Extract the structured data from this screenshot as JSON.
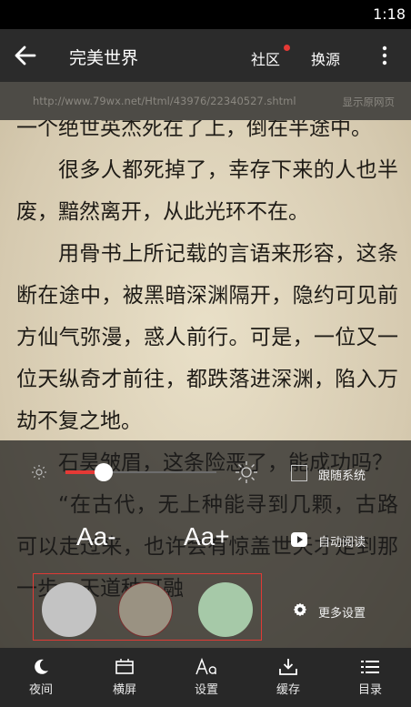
{
  "status_bar": {
    "time": "1:18"
  },
  "header": {
    "title": "完美世界",
    "community": "社区",
    "change_source": "换源"
  },
  "url_bar": {
    "url": "http://www.79wx.net/Html/43976/22340527.shtml",
    "show_original": "显示原网页"
  },
  "content": {
    "paragraphs": [
      {
        "text": "一个绝世英杰死在了上，倒在半途中。",
        "indent": false
      },
      {
        "text": "很多人都死掉了，幸存下来的人也半废，黯然离开，从此光环不在。",
        "indent": true
      },
      {
        "text": "用骨书上所记载的言语来形容，这条断在途中，被黑暗深渊隔开，隐约可见前方仙气弥漫，惑人前行。可是，一位又一位天纵奇才前往，都跌落进深渊，陷入万劫不复之地。",
        "indent": true
      },
      {
        "text": "石昊皱眉，这条险恶了，能成功吗？",
        "indent": true
      },
      {
        "text": "“在古代，无上种能寻到几颗，古路可以走过来，也许会有惊盖世天才走到那一步，天道种可融",
        "indent": true
      }
    ]
  },
  "settings": {
    "brightness": 0.25,
    "follow_system_label": "跟随系统",
    "follow_system_checked": false,
    "font_decrease": "Aa-",
    "font_increase": "Aa+",
    "auto_read": "自动阅读",
    "more_settings": "更多设置",
    "themes": [
      {
        "name": "gray",
        "color": "#c3c3c3"
      },
      {
        "name": "parchment",
        "color": "#9a9282",
        "selected": true
      },
      {
        "name": "green",
        "color": "#a6c9a8"
      }
    ],
    "highlight_color": "#e03a35"
  },
  "bottom_bar": {
    "tabs": [
      {
        "label": "夜间",
        "icon": "moon-icon"
      },
      {
        "label": "横屏",
        "icon": "landscape-icon"
      },
      {
        "label": "设置",
        "icon": "font-settings-icon"
      },
      {
        "label": "缓存",
        "icon": "download-icon"
      },
      {
        "label": "目录",
        "icon": "list-icon"
      }
    ]
  },
  "colors": {
    "accent": "#e53935",
    "page_bg": "#d8cdb3",
    "toolbar": "#2b2b2b"
  }
}
